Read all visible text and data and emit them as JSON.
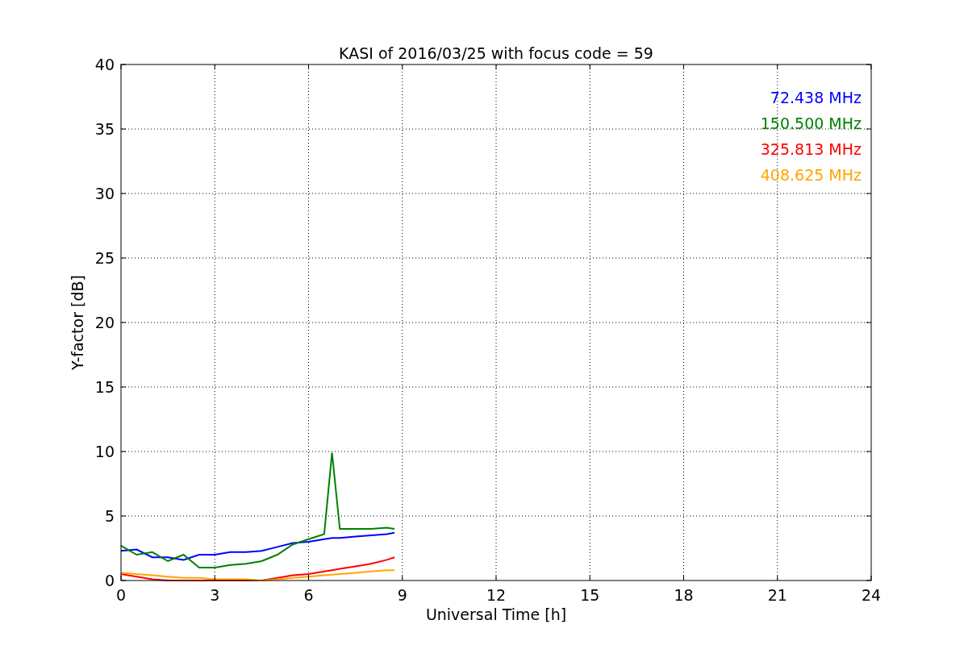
{
  "chart_data": {
    "type": "line",
    "title": "KASI of 2016/03/25 with focus code = 59",
    "xlabel": "Universal Time [h]",
    "ylabel": "Y-factor [dB]",
    "x": [
      0,
      0.5,
      1,
      1.5,
      2,
      2.5,
      3,
      3.5,
      4,
      4.5,
      5,
      5.5,
      6,
      6.5,
      6.75,
      7,
      7.5,
      8,
      8.5,
      8.75
    ],
    "series": [
      {
        "name": "72.438 MHz",
        "color": "#0000ff",
        "values": [
          2.3,
          2.4,
          1.8,
          1.8,
          1.6,
          2.0,
          2.0,
          2.2,
          2.2,
          2.3,
          2.6,
          2.9,
          3.0,
          3.2,
          3.3,
          3.3,
          3.4,
          3.5,
          3.6,
          3.7
        ]
      },
      {
        "name": "150.500 MHz",
        "color": "#008000",
        "values": [
          2.7,
          2.0,
          2.2,
          1.5,
          2.0,
          1.0,
          1.0,
          1.2,
          1.3,
          1.5,
          2.0,
          2.8,
          3.2,
          3.6,
          9.9,
          4.0,
          4.0,
          4.0,
          4.1,
          4.0
        ]
      },
      {
        "name": "325.813 MHz",
        "color": "#ff0000",
        "values": [
          0.5,
          0.3,
          0.1,
          0,
          0,
          0,
          0,
          0,
          0,
          0,
          0.2,
          0.4,
          0.5,
          0.7,
          0.8,
          0.9,
          1.1,
          1.3,
          1.6,
          1.8
        ]
      },
      {
        "name": "408.625 MHz",
        "color": "#ffa500",
        "values": [
          0.6,
          0.5,
          0.4,
          0.3,
          0.2,
          0.2,
          0.1,
          0.1,
          0.1,
          0,
          0.1,
          0.2,
          0.3,
          0.4,
          0.45,
          0.5,
          0.6,
          0.7,
          0.8,
          0.8
        ]
      }
    ],
    "xlim": [
      0,
      24
    ],
    "ylim": [
      0,
      40
    ],
    "xticks": [
      0,
      3,
      6,
      9,
      12,
      15,
      18,
      21,
      24
    ],
    "yticks": [
      0,
      5,
      10,
      15,
      20,
      25,
      30,
      35,
      40
    ],
    "grid": true
  }
}
